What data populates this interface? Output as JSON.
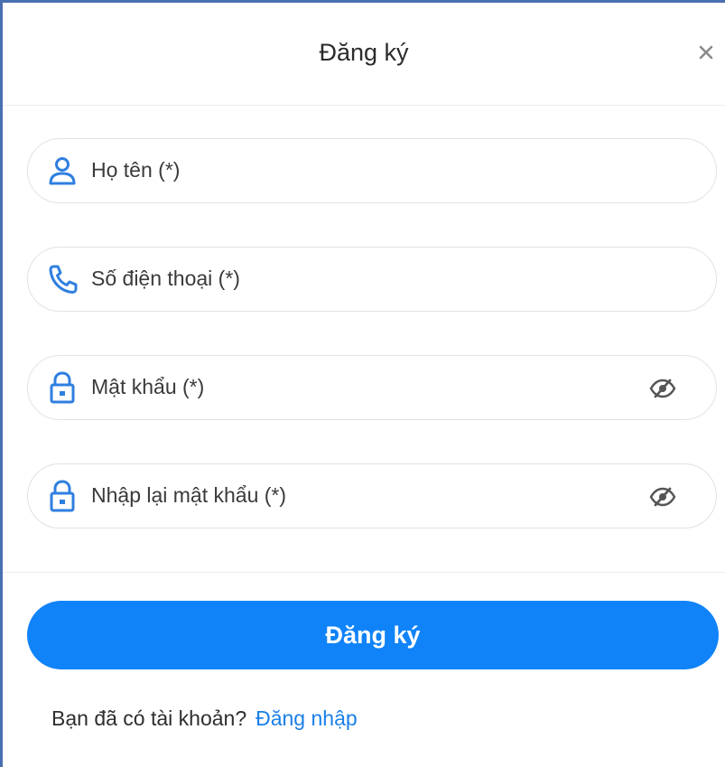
{
  "dialog": {
    "title": "Đăng ký",
    "close_icon": "close-icon"
  },
  "fields": [
    {
      "placeholder": "Họ tên (*)",
      "icon": "user-icon"
    },
    {
      "placeholder": "Số điện thoại (*)",
      "icon": "phone-icon"
    },
    {
      "placeholder": "Mật khẩu (*)",
      "icon": "lock-icon",
      "toggle_icon": "eye-off-icon"
    },
    {
      "placeholder": "Nhập lại mật khẩu (*)",
      "icon": "lock-icon",
      "toggle_icon": "eye-off-icon"
    }
  ],
  "submit": {
    "label": "Đăng ký"
  },
  "footer": {
    "prompt": "Bạn đã có tài khoản?",
    "login_link": "Đăng nhập"
  },
  "colors": {
    "accent": "#1083f8",
    "icon": "#2f7fe0",
    "border": "#e2e2e2"
  }
}
